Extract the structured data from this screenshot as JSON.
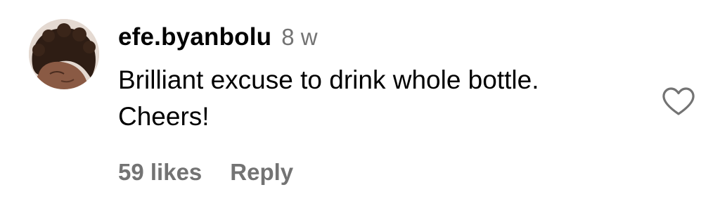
{
  "comment": {
    "username": "efe.byanbolu",
    "timestamp": "8 w",
    "text_lines": [
      "Brilliant excuse to drink whole bottle.",
      "Cheers!"
    ],
    "likes_label": "59 likes",
    "reply_label": "Reply",
    "like_icon": "heart-outline-icon",
    "avatar_icon": "profile-photo"
  },
  "colors": {
    "primary_text": "#000000",
    "secondary_text": "#737373",
    "background": "#ffffff"
  }
}
